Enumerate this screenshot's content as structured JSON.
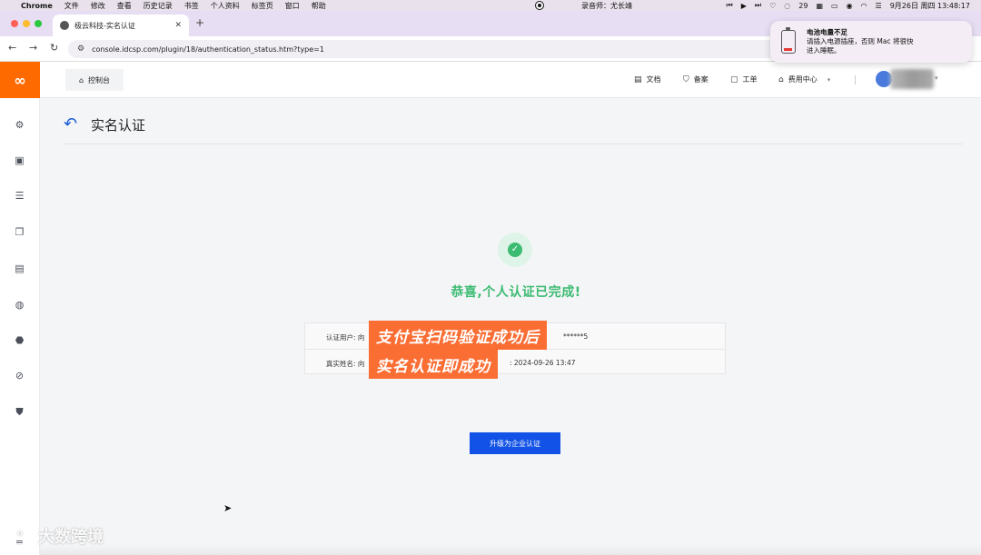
{
  "menubar": {
    "app": "Chrome",
    "items": [
      "文件",
      "修改",
      "查看",
      "历史记录",
      "书签",
      "个人资料",
      "标签页",
      "窗口",
      "帮助"
    ],
    "recorder": "录音师：尤长靖",
    "notif_count": "29",
    "datetime": "9月26日 周四  13:48:17"
  },
  "browser": {
    "tab_title": "极云科技-实名认证",
    "url": "console.idcsp.com/plugin/18/authentication_status.htm?type=1"
  },
  "notification": {
    "title": "电池电量不足",
    "body_line1": "请插入电源插座，否则 Mac 将很快",
    "body_line2": "进入睡眠。"
  },
  "header": {
    "console_label": "控制台",
    "nav": [
      {
        "icon": "document-icon",
        "label": "文档"
      },
      {
        "icon": "shield-icon",
        "label": "备案"
      },
      {
        "icon": "ticket-icon",
        "label": "工单"
      },
      {
        "icon": "billing-icon",
        "label": "费用中心"
      }
    ]
  },
  "sidebar": {
    "icons": [
      "settings-icon",
      "cloud-server-icon",
      "storage-icon",
      "copy-icon",
      "server-add-icon",
      "globe-icon",
      "ssl-icon",
      "block-icon",
      "security-icon"
    ]
  },
  "page": {
    "title": "实名认证",
    "success_message": "恭喜,个人认证已完成!",
    "row1_label": "认证用户: 向",
    "row1_masked_tail": "******5",
    "row2_label": "真实姓名: 向",
    "row2_time_tail": ": 2024-09-26 13:47",
    "upgrade_button": "升级为企业认证"
  },
  "overlay": {
    "line1": "支付宝扫码验证成功后",
    "line2": "实名认证即成功"
  },
  "watermark": "大数跨境",
  "colors": {
    "brand_orange": "#ff6a00",
    "success_green": "#3cbb72",
    "primary_blue": "#1252e6",
    "overlay_orange": "#fa6d33"
  }
}
